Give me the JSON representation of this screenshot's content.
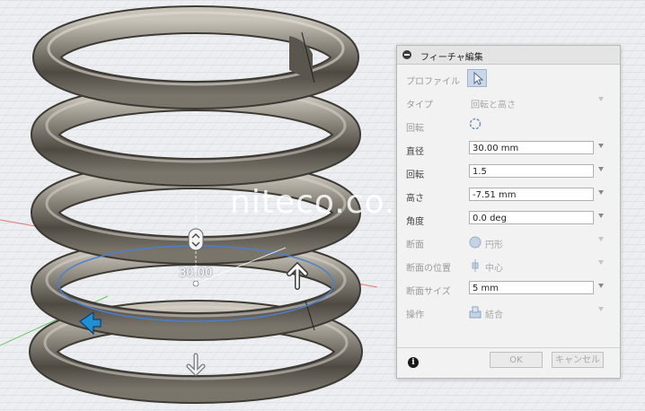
{
  "watermark": "niteco.co.jp",
  "viewport": {
    "dimension_label": "30.00"
  },
  "panel": {
    "title": "フィーチャ編集",
    "rows": [
      {
        "label": "プロファイル"
      },
      {
        "label": "タイプ",
        "value": "回転と高さ"
      },
      {
        "label": "回転"
      },
      {
        "label": "直径",
        "value": "30.00 mm"
      },
      {
        "label": "回転",
        "value": "1.5"
      },
      {
        "label": "高さ",
        "value": "-7.51 mm"
      },
      {
        "label": "角度",
        "value": "0.0 deg"
      },
      {
        "label": "断面",
        "value": "円形"
      },
      {
        "label": "断面の位置",
        "value": "中心"
      },
      {
        "label": "断面サイズ",
        "value": "5 mm"
      },
      {
        "label": "操作",
        "value": "結合"
      }
    ],
    "ok_label": "OK",
    "cancel_label": "キャンセル"
  },
  "icons": {
    "collapse": "minus-circle-icon",
    "select": "cursor-arrow-icon",
    "rotate": "rotate-dashed-circle-icon",
    "section": "circle-icon",
    "position": "center-align-icon",
    "operation": "join-icon",
    "info": "info-icon"
  }
}
